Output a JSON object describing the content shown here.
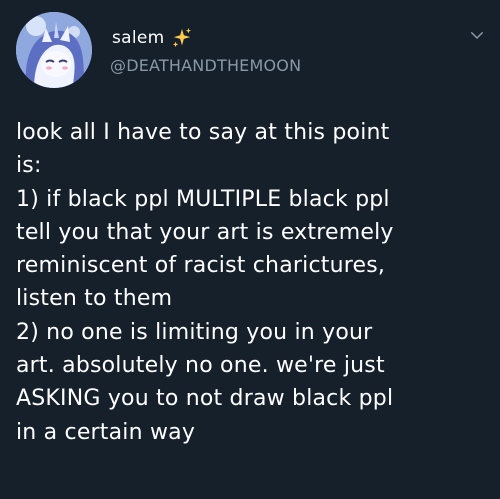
{
  "tweet": {
    "author": {
      "display_name": "salem",
      "name_emoji": "sparkles-icon",
      "handle": "@DEATHANDTHEMOON",
      "avatar": "avatar-image"
    },
    "menu_icon": "chevron-down-icon",
    "text_lines": [
      "look all I have to say at this point",
      "is:",
      "1) if black ppl MULTIPLE black ppl",
      "tell you that your art is extremely",
      "reminiscent of racist charictures,",
      "listen to them",
      "2) no one is limiting you in your",
      "art. absolutely no one. we're just",
      "ASKING you to not draw black ppl",
      "in a certain way"
    ],
    "colors": {
      "background": "#15202b",
      "text": "#ffffff",
      "secondary_text": "#8899a6",
      "sparkle": "#ffcc4d"
    }
  }
}
